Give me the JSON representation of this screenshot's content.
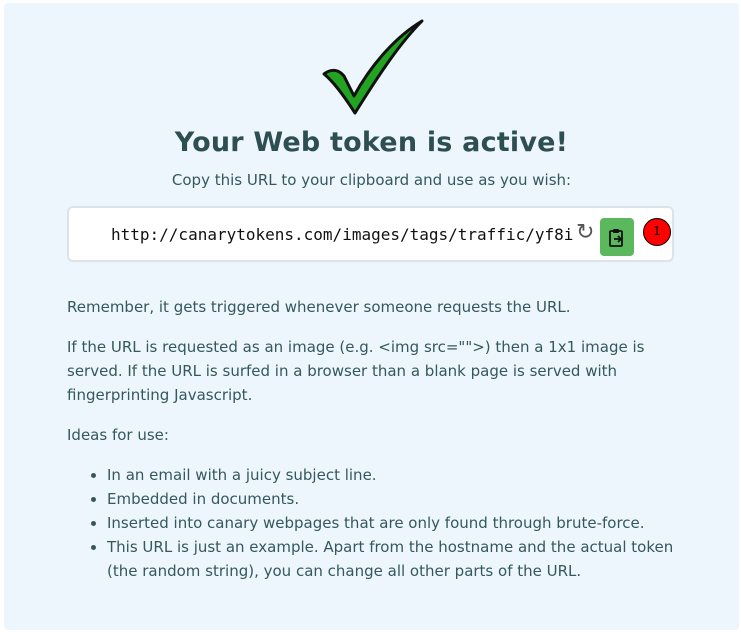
{
  "header": {
    "title": "Your Web token is active!",
    "subtitle": "Copy this URL to your clipboard and use as you wish:"
  },
  "token": {
    "url": "http://canarytokens.com/images/tags/traffic/yf8i",
    "refresh_icon": "refresh-icon",
    "copy_icon": "clipboard-icon",
    "badge_count": "1",
    "colors": {
      "copy_button": "#5cb85c",
      "badge": "#ff0000",
      "check": "#22a322"
    }
  },
  "content": {
    "p1": "Remember, it gets triggered whenever someone requests the URL.",
    "p2": "If the URL is requested as an image (e.g. <img src=\"\">) then a 1x1 image is served. If the URL is surfed in a browser than a blank page is served with fingerprinting Javascript.",
    "p3": "Ideas for use:",
    "ideas": [
      "In an email with a juicy subject line.",
      "Embedded in documents.",
      "Inserted into canary webpages that are only found through brute-force.",
      "This URL is just an example. Apart from the hostname and the actual token (the random string), you can change all other parts of the URL."
    ]
  }
}
